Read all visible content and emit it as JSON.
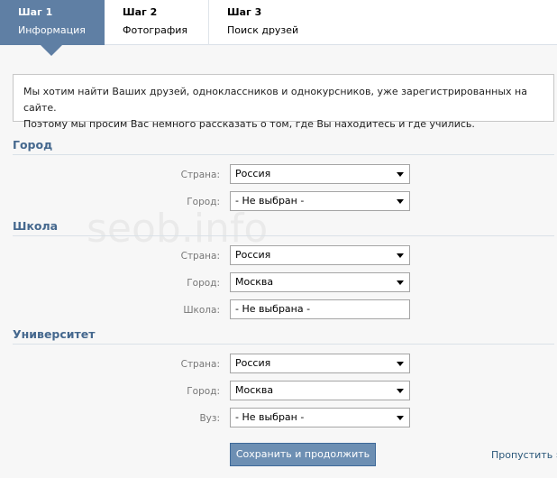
{
  "steps": [
    {
      "num": "Шаг 1",
      "name": "Информация"
    },
    {
      "num": "Шаг 2",
      "name": "Фотография"
    },
    {
      "num": "Шаг 3",
      "name": "Поиск друзей"
    }
  ],
  "info": {
    "line1": "Мы хотим найти Ваших друзей, одноклассников и однокурсников, уже зарегистрированных на сайте.",
    "line2": "Поэтому мы просим Вас немного рассказать о том, где Вы находитесь и где учились."
  },
  "city_section": {
    "title": "Город",
    "country_label": "Страна:",
    "country_value": "Россия",
    "city_label": "Город:",
    "city_value": "- Не выбран -"
  },
  "school_section": {
    "title": "Школа",
    "country_label": "Страна:",
    "country_value": "Россия",
    "city_label": "Город:",
    "city_value": "Москва",
    "school_label": "Школа:",
    "school_value": "- Не выбрана -"
  },
  "university_section": {
    "title": "Университет",
    "country_label": "Страна:",
    "country_value": "Россия",
    "city_label": "Город:",
    "city_value": "Москва",
    "university_label": "Вуз:",
    "university_value": "- Не выбран -"
  },
  "watermark": "seob.info",
  "actions": {
    "submit_label": "Сохранить и продолжить",
    "skip_label": "Пропустить »"
  },
  "colors": {
    "active_tab": "#5f7fa4",
    "section_title": "#45688e",
    "button": "#6d8fb3",
    "link": "#2b587a"
  }
}
